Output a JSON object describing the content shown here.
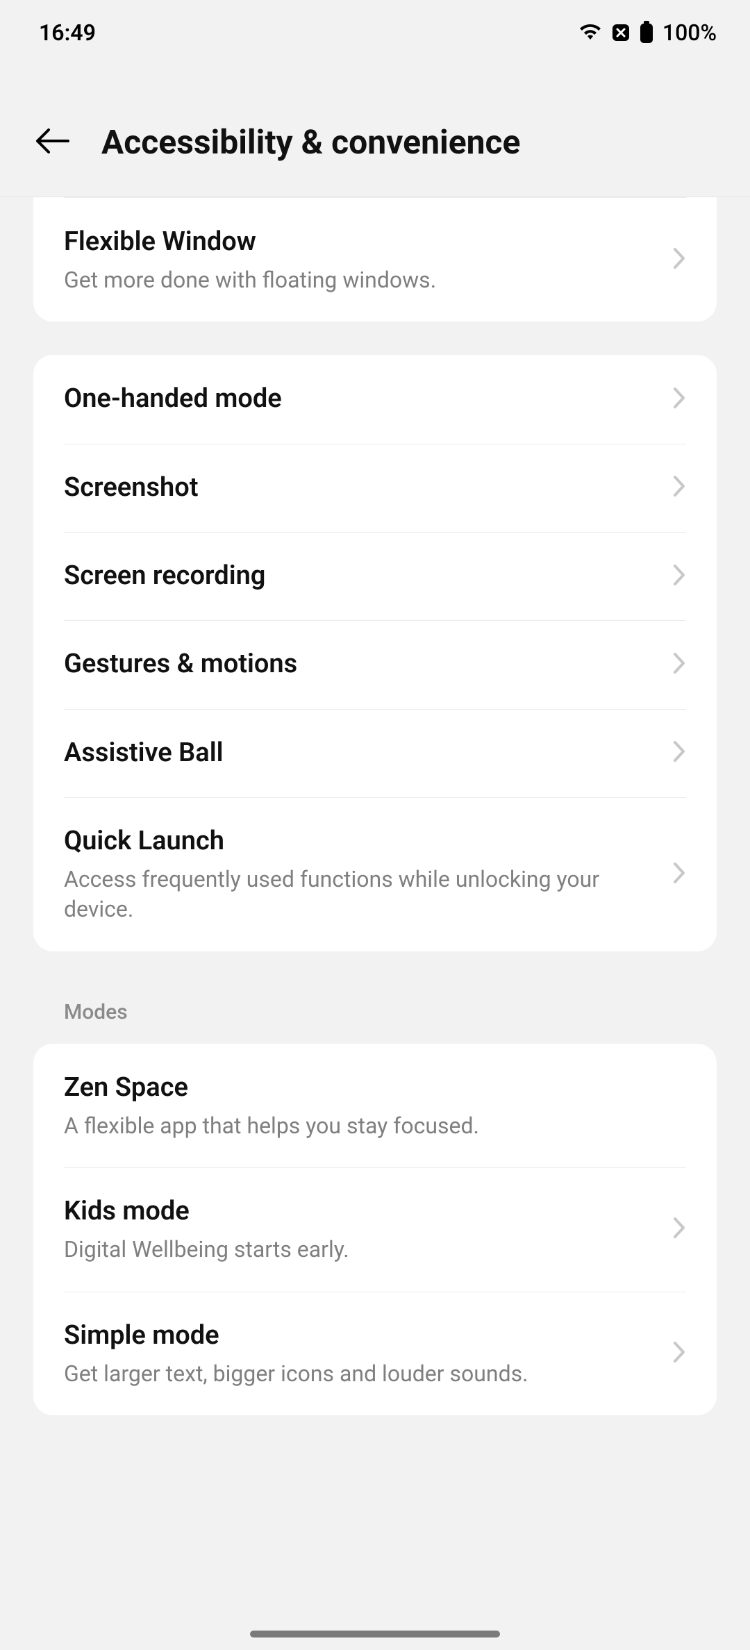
{
  "status": {
    "time": "16:49",
    "battery": "100%"
  },
  "header": {
    "title": "Accessibility & convenience"
  },
  "group1": {
    "items": [
      {
        "title": "Flexible Window",
        "sub": "Get more done with floating windows."
      }
    ]
  },
  "group2": {
    "items": [
      {
        "title": "One-handed mode"
      },
      {
        "title": "Screenshot"
      },
      {
        "title": "Screen recording"
      },
      {
        "title": "Gestures & motions"
      },
      {
        "title": "Assistive Ball"
      },
      {
        "title": "Quick Launch",
        "sub": "Access frequently used functions while unlocking your device."
      }
    ]
  },
  "section_modes": "Modes",
  "group3": {
    "items": [
      {
        "title": "Zen Space",
        "sub": "A flexible app that helps you stay focused."
      },
      {
        "title": "Kids mode",
        "sub": "Digital Wellbeing starts early."
      },
      {
        "title": "Simple mode",
        "sub": "Get larger text, bigger icons and louder sounds."
      }
    ]
  }
}
